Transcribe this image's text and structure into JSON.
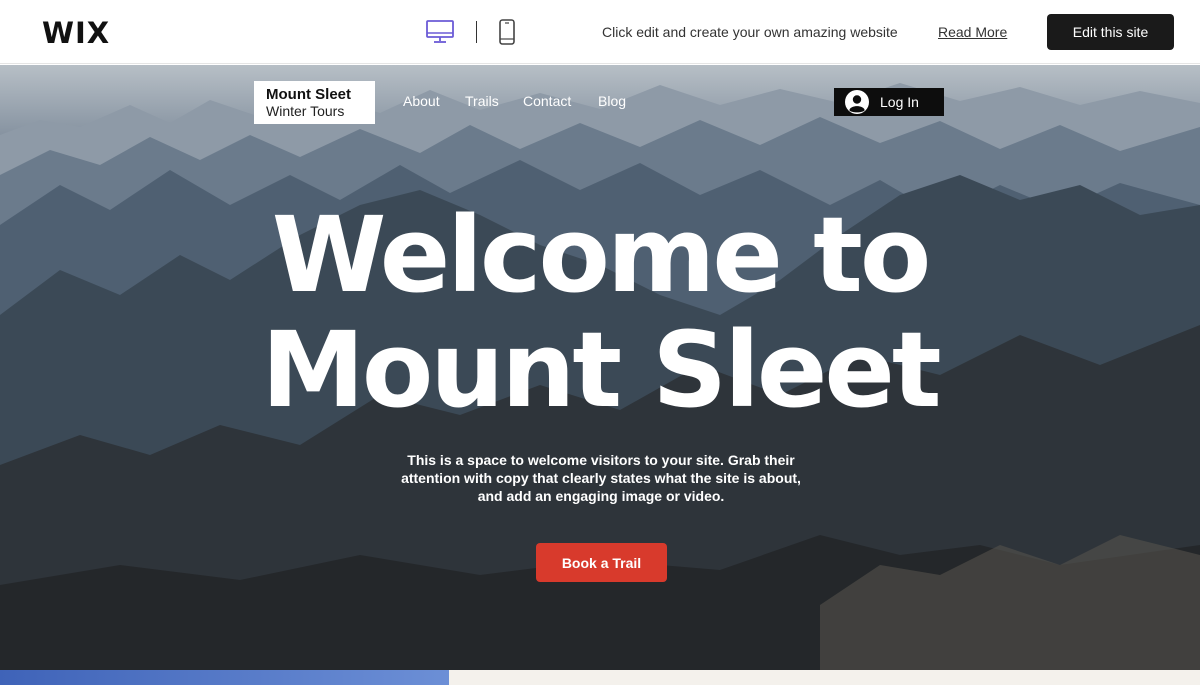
{
  "wix_bar": {
    "logo": "WIX",
    "message": "Click edit and create your own amazing website",
    "read_more": "Read More",
    "edit_button": "Edit this site",
    "devices": [
      "desktop-icon",
      "mobile-icon"
    ],
    "selected_device": "desktop"
  },
  "site": {
    "brand_title": "Mount Sleet",
    "brand_subtitle": "Winter Tours",
    "nav": [
      "About",
      "Trails",
      "Contact",
      "Blog"
    ],
    "login_label": "Log In",
    "headline_line1": "Welcome to",
    "headline_line2": "Mount Sleet",
    "description": "This is a space to welcome visitors to your site. Grab their attention with copy that clearly states what the site is about, and add an engaging image or video.",
    "cta_button": "Book a Trail"
  },
  "colors": {
    "cta": "#d83a2c",
    "edit_button": "#1a1a1a",
    "accent_device": "#6b5bd6"
  }
}
